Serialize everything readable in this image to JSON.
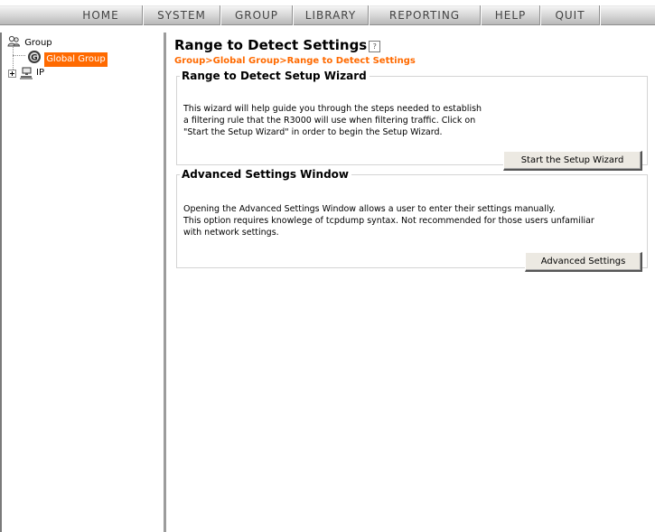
{
  "menu": {
    "items": [
      "HOME",
      "SYSTEM",
      "GROUP",
      "LIBRARY",
      "REPORTING",
      "HELP",
      "QUIT"
    ]
  },
  "tree": {
    "root_label": "Group",
    "global_group_label": "Global Group",
    "ip_label": "IP"
  },
  "main": {
    "title": "Range to Detect Settings",
    "breadcrumb": "Group>Global Group>Range to Detect Settings",
    "wizard": {
      "legend": "Range to Detect Setup Wizard",
      "lines": [
        "This wizard will help guide you through the steps needed to establish",
        "a filtering rule that the R3000 will use when filtering traffic. Click on",
        "\"Start the Setup Wizard\" in order to begin the Setup Wizard."
      ],
      "button": "Start the Setup Wizard"
    },
    "advanced": {
      "legend": "Advanced Settings Window",
      "lines": [
        "Opening the Advanced Settings Window allows a user to enter their settings manually.",
        "This option requires knowlege of tcpdump syntax. Not recommended for those users unfamiliar",
        "with network settings."
      ],
      "button": "Advanced Settings"
    }
  },
  "colors": {
    "accent": "#ff6a00"
  },
  "icons": {
    "help": "help-icon",
    "group_root": "group-users-icon",
    "global_group": "global-group-badge-icon",
    "ip": "network-computer-icon"
  }
}
